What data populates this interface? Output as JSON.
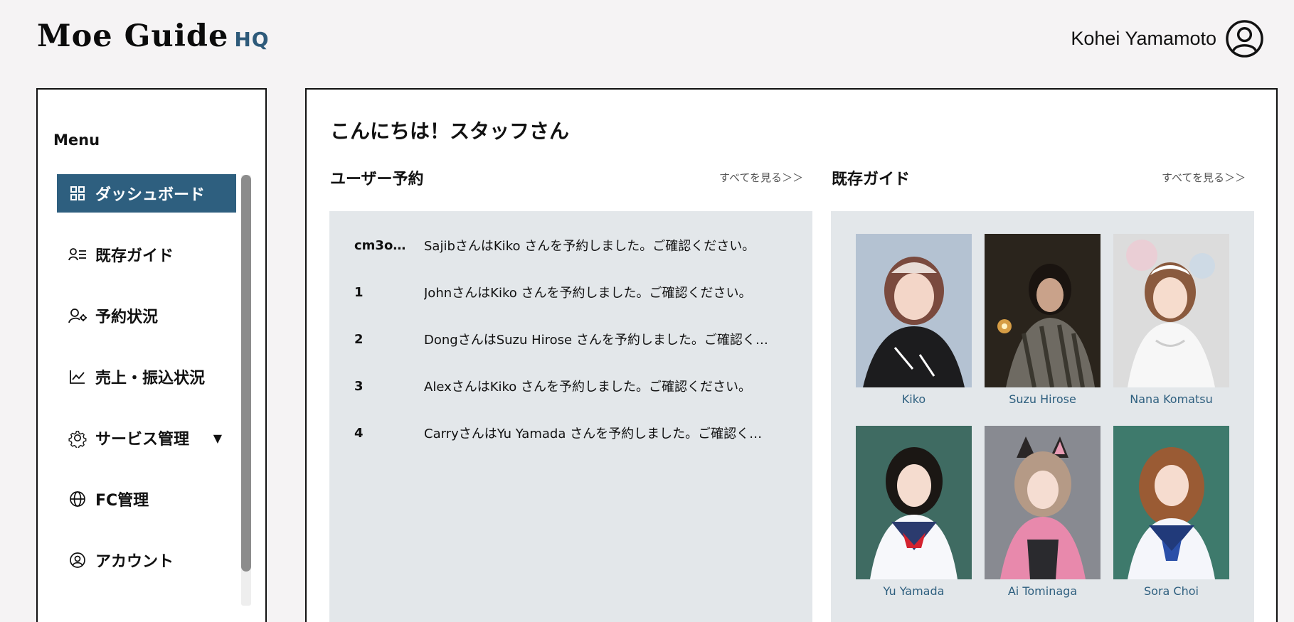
{
  "header": {
    "logo_main": "Moe Guide",
    "logo_sub": "HQ",
    "user_name": "Kohei Yamamoto"
  },
  "sidebar": {
    "title": "Menu",
    "items": [
      {
        "label": "ダッシュボード",
        "icon": "grid-icon",
        "active": true
      },
      {
        "label": "既存ガイド",
        "icon": "user-list-icon"
      },
      {
        "label": "予約状況",
        "icon": "user-gear-icon"
      },
      {
        "label": "売上・振込状況",
        "icon": "trend-chart-icon"
      },
      {
        "label": "サービス管理",
        "icon": "gear-icon",
        "has_dropdown": true
      },
      {
        "label": "FC管理",
        "icon": "globe-icon"
      },
      {
        "label": "アカウント",
        "icon": "user-circle-icon"
      }
    ]
  },
  "main": {
    "greeting": "こんにちは！スタッフさん",
    "reservations": {
      "title": "ユーザー予約",
      "see_all": "すべてを見る＞＞",
      "rows": [
        {
          "id": "cm3o…",
          "text": "SajibさんはKiko さんを予約しました。ご確認ください。"
        },
        {
          "id": "1",
          "text": "JohnさんはKiko さんを予約しました。ご確認ください。"
        },
        {
          "id": "2",
          "text": "DongさんはSuzu Hirose さんを予約しました。ご確認く…"
        },
        {
          "id": "3",
          "text": "AlexさんはKiko さんを予約しました。ご確認ください。"
        },
        {
          "id": "4",
          "text": "CarryさんはYu Yamada さんを予約しました。ご確認く…"
        }
      ]
    },
    "guides": {
      "title": "既存ガイド",
      "see_all": "すべてを見る＞＞",
      "items": [
        {
          "name": "Kiko"
        },
        {
          "name": "Suzu Hirose"
        },
        {
          "name": "Nana Komatsu"
        },
        {
          "name": "Yu Yamada"
        },
        {
          "name": "Ai Tominaga"
        },
        {
          "name": "Sora Choi"
        }
      ]
    }
  },
  "colors": {
    "accent": "#2e5f7f",
    "panel_bg": "#e3e7ea",
    "page_bg": "#f5f3f4"
  }
}
